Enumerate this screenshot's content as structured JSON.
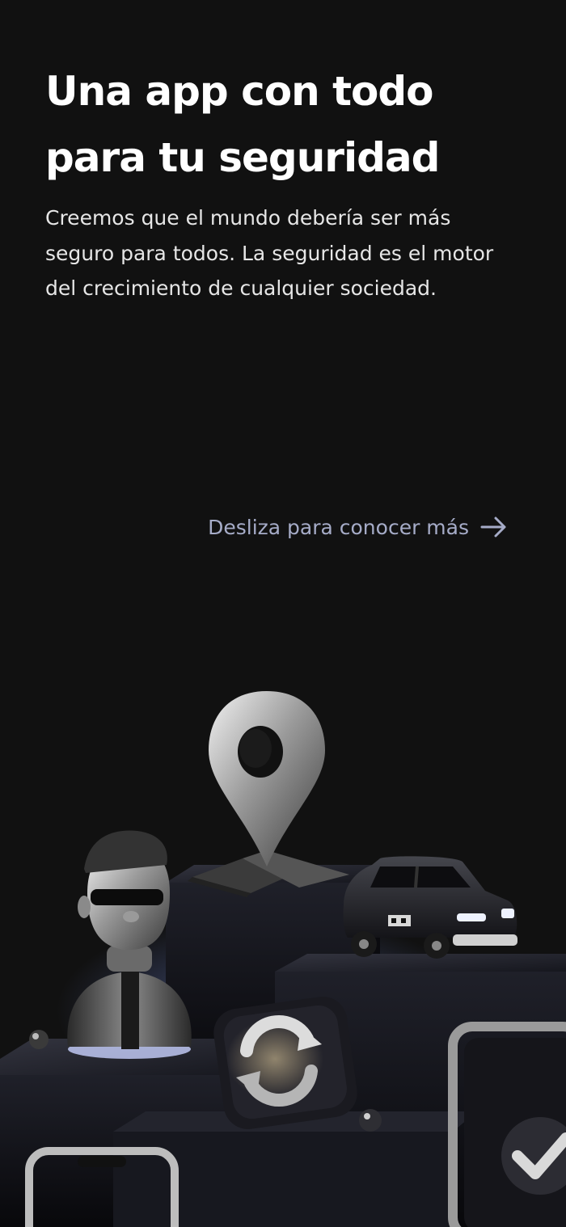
{
  "hero": {
    "title_line1": "Una app con todo",
    "title_line2": "para tu seguridad",
    "description": "Creemos que el mundo debería ser más seguro para todos. La seguridad es el motor del crecimiento de cualquier sociedad."
  },
  "swipe_hint": {
    "label": "Desliza para conocer más",
    "icon": "arrow-right-icon"
  },
  "illustration": {
    "elements": [
      "location-pin-icon",
      "guard-figure-icon",
      "taxi-car-icon",
      "refresh-sync-icon",
      "checkmark-shield-icon"
    ]
  },
  "colors": {
    "background": "#111111",
    "title": "#ffffff",
    "text": "#e6e6e6",
    "accent_hint": "#a6acc8",
    "glow": "#6f86d9"
  }
}
